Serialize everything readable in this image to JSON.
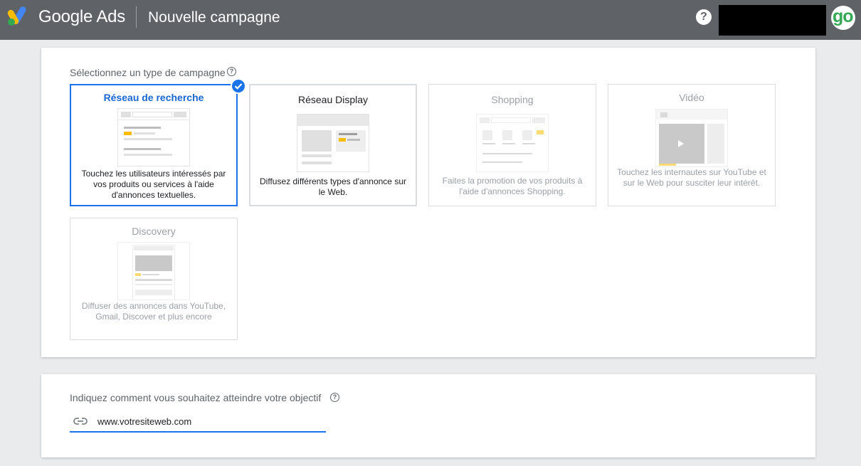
{
  "header": {
    "brand": "Google Ads",
    "page_title": "Nouvelle campagne",
    "help_symbol": "?",
    "avatar_text": "go",
    "colors": {
      "bar": "#5f6368",
      "accent": "#1a73e8",
      "avatar": "#34a853"
    },
    "icons": {
      "logo": "google-ads-logo",
      "help": "help-circle-icon"
    }
  },
  "campaign_type": {
    "label": "Sélectionnez un type de campagne",
    "help_symbol": "?",
    "cards": [
      {
        "title": "Réseau de recherche",
        "description": "Touchez les utilisateurs intéressés par vos produits ou services à l'aide d'annonces textuelles.",
        "state": "selected"
      },
      {
        "title": "Réseau Display",
        "description": "Diffusez différents types d'annonce sur le Web.",
        "state": "active"
      },
      {
        "title": "Shopping",
        "description": "Faites la promotion de vos produits à l'aide d'annonces Shopping.",
        "state": "disabled"
      },
      {
        "title": "Vidéo",
        "description": "Touchez les internautes sur YouTube et sur le Web pour susciter leur intérêt.",
        "state": "disabled"
      },
      {
        "title": "Discovery",
        "description": "Diffuser des annonces dans YouTube, Gmail, Discover et plus encore",
        "state": "disabled"
      }
    ]
  },
  "objective": {
    "label": "Indiquez comment vous souhaitez atteindre votre objectif",
    "help_symbol": "?",
    "url_value": "www.votresiteweb.com",
    "icon": "link-icon"
  }
}
